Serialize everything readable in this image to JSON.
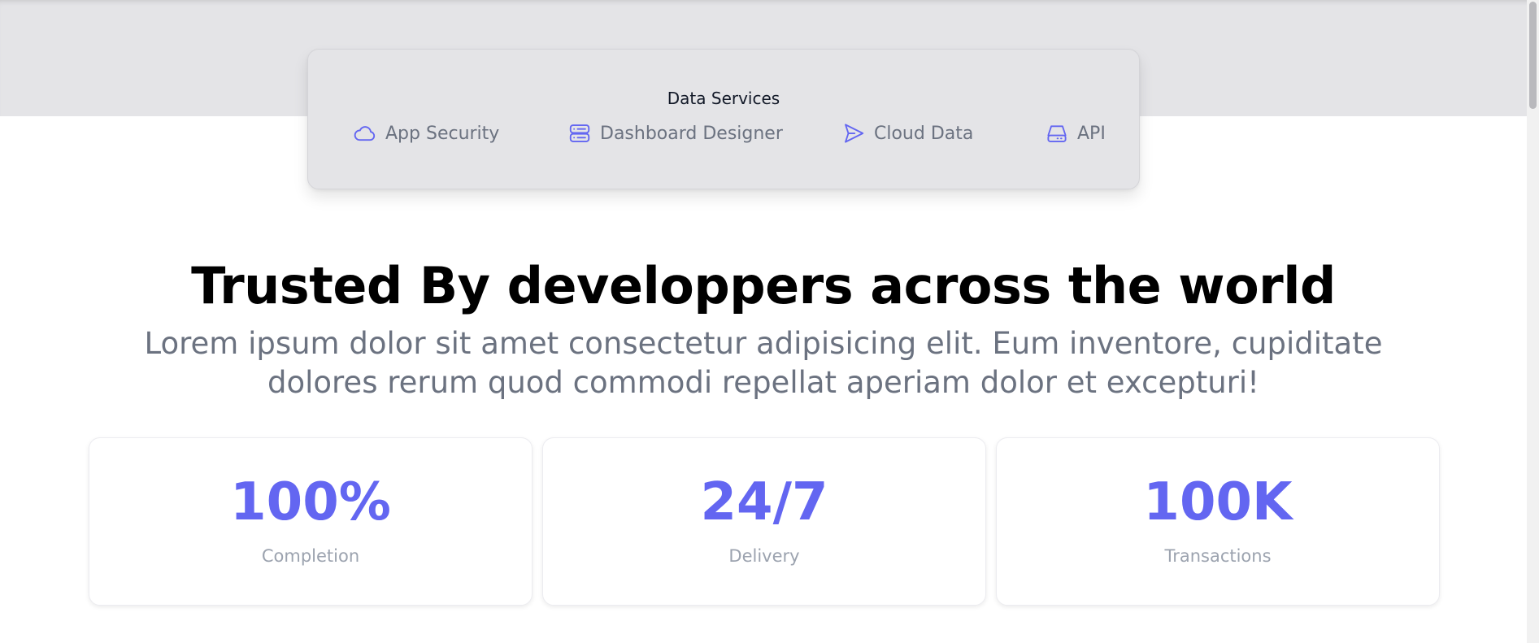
{
  "services": {
    "title": "Data Services",
    "items": [
      {
        "label": "App Security",
        "icon": "cloud-icon"
      },
      {
        "label": "Dashboard Designer",
        "icon": "server-icon"
      },
      {
        "label": "Cloud Data",
        "icon": "send-icon"
      },
      {
        "label": "API",
        "icon": "hard-drive-icon"
      }
    ]
  },
  "hero": {
    "title": "Trusted By developpers across the world",
    "subtitle": "Lorem ipsum dolor sit amet consectetur adipisicing elit. Eum inventore, cupiditate dolores rerum quod commodi repellat aperiam dolor et excepturi!"
  },
  "stats": [
    {
      "value": "100%",
      "label": "Completion"
    },
    {
      "value": "24/7",
      "label": "Delivery"
    },
    {
      "value": "100K",
      "label": "Transactions"
    }
  ],
  "colors": {
    "accent": "#6366f1",
    "band": "#e4e4e7",
    "muted_text": "#6b7280"
  }
}
